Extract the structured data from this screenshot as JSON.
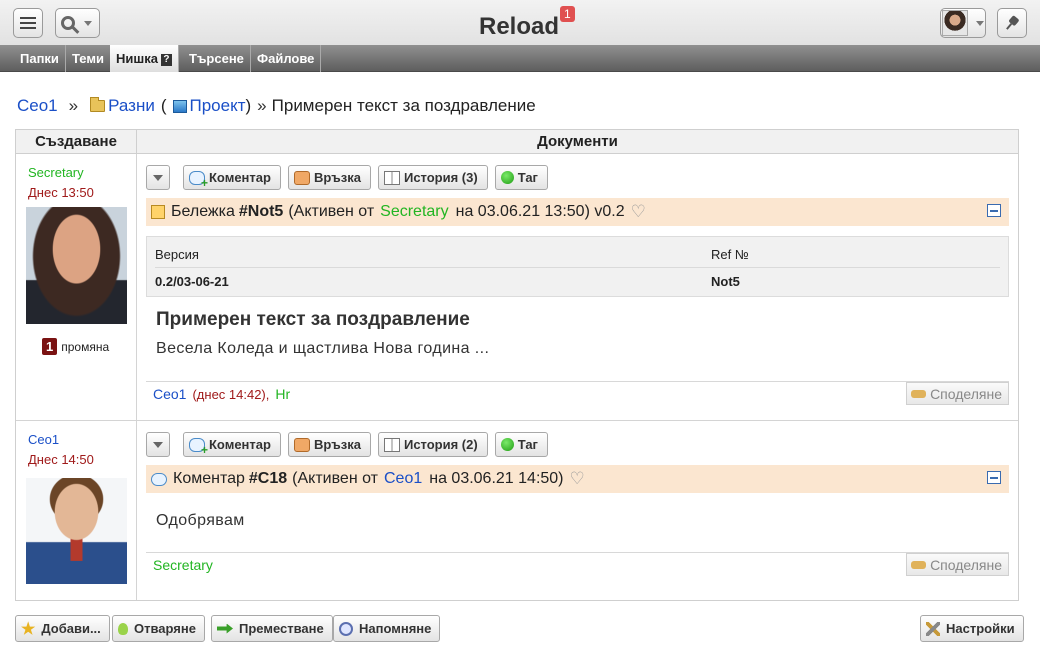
{
  "topbar": {
    "app_title": "Reload",
    "notification_count": "1"
  },
  "nav": {
    "tabs": [
      "Папки",
      "Теми",
      "Нишка",
      "Търсене",
      "Файлове"
    ],
    "active_help": "?"
  },
  "breadcrumb": {
    "root": "Сео1",
    "sep1": "»",
    "folder": "Разни",
    "open_paren": "(",
    "project": "Проект",
    "close_paren": ")",
    "sep2": "»",
    "current": "Примерен текст за поздравление"
  },
  "table": {
    "col_left": "Създаване",
    "col_right": "Документи"
  },
  "entries": [
    {
      "author": "Secretary",
      "time": "Днес 13:50",
      "changes_count": "1",
      "changes_label": "промяна",
      "buttons": {
        "comment": "Коментар",
        "link": "Връзка",
        "history": "История (3)",
        "tag": "Таг"
      },
      "kind": "Бележка",
      "ref": "#Not5",
      "status_open": "(Активен от",
      "status_user": "Secretary",
      "status_rest": "на 03.06.21 13:50) v0.2",
      "meta": {
        "h_version": "Версия",
        "h_ref": "Ref №",
        "v_version": "0.2/03-06-21",
        "v_ref": "Not5"
      },
      "title": "Примерен текст за поздравление",
      "body": "Весела Коледа и щастлива Нова година ...",
      "footer_user": "Сео1",
      "footer_time": "(днес 14:42),",
      "footer_user2": "Hr",
      "share": "Споделяне"
    },
    {
      "author": "Сео1",
      "time": "Днес 14:50",
      "buttons": {
        "comment": "Коментар",
        "link": "Връзка",
        "history": "История (2)",
        "tag": "Таг"
      },
      "kind": "Коментар",
      "ref": "#C18",
      "status_open": "(Активен от",
      "status_user": "Сео1",
      "status_rest": "на 03.06.21 14:50)",
      "body": "Одобрявам",
      "footer_user": "Secretary",
      "share": "Споделяне"
    }
  ],
  "bottom": {
    "add": "Добави...",
    "open": "Отваряне",
    "move": "Преместване",
    "remind": "Напомняне",
    "settings": "Настройки"
  },
  "colors": {
    "accent_blue": "#1a4fc7",
    "user_green": "#22b522",
    "note_bar": "#fbe6d0",
    "badge_dark_red": "#7a1212"
  }
}
